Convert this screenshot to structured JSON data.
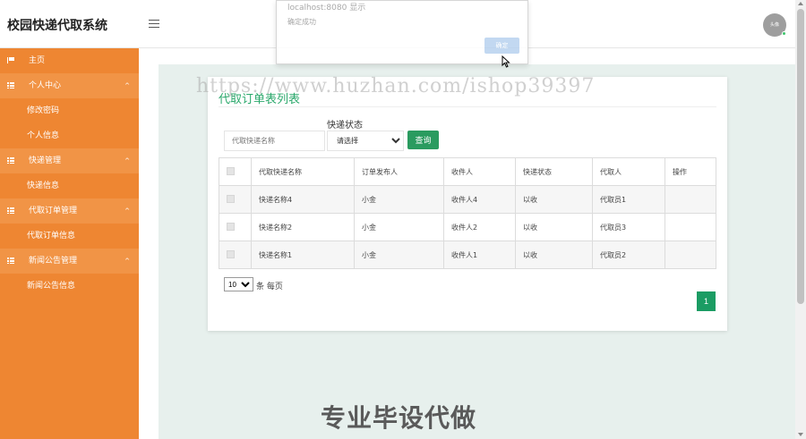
{
  "header": {
    "app_title": "校园快递代取系统",
    "avatar_text": "头像"
  },
  "sidebar": {
    "items": [
      {
        "label": "主页",
        "type": "top",
        "icon": "flag-icon"
      },
      {
        "label": "个人中心",
        "type": "group",
        "icon": "grid-icon"
      },
      {
        "label": "修改密码",
        "type": "sub"
      },
      {
        "label": "个人信息",
        "type": "sub"
      },
      {
        "label": "快递管理",
        "type": "group",
        "icon": "grid-icon"
      },
      {
        "label": "快递信息",
        "type": "sub"
      },
      {
        "label": "代取订单管理",
        "type": "group",
        "icon": "grid-icon"
      },
      {
        "label": "代取订单信息",
        "type": "sub"
      },
      {
        "label": "新闻公告管理",
        "type": "group",
        "icon": "grid-icon"
      },
      {
        "label": "新闻公告信息",
        "type": "sub"
      }
    ]
  },
  "main": {
    "card_title": "代取订单表列表",
    "filter": {
      "status_label": "快递状态",
      "name_placeholder": "代取快递名称",
      "status_selected": "请选择",
      "query_label": "查询"
    },
    "table": {
      "columns": [
        "代取快递名称",
        "订单发布人",
        "收件人",
        "快递状态",
        "代取人",
        "操作"
      ],
      "rows": [
        [
          "快递名称4",
          "小金",
          "收件人4",
          "以收",
          "代取员1",
          ""
        ],
        [
          "快递名称2",
          "小金",
          "收件人2",
          "以收",
          "代取员3",
          ""
        ],
        [
          "快递名称1",
          "小金",
          "收件人1",
          "以收",
          "代取员2",
          ""
        ]
      ]
    },
    "pagination": {
      "page_size": "10",
      "page_size_suffix": "条 每页",
      "current_page": "1"
    }
  },
  "dialog": {
    "origin": "localhost:8080 显示",
    "message": "确定成功",
    "ok_label": "确定"
  },
  "watermarks": {
    "url": "https://www.huzhan.com/ishop39397",
    "bottom": "专业毕设代做"
  },
  "colors": {
    "sidebar": "#ee8632",
    "accent_green": "#2a9b5f",
    "title_green": "#2aa86b"
  }
}
